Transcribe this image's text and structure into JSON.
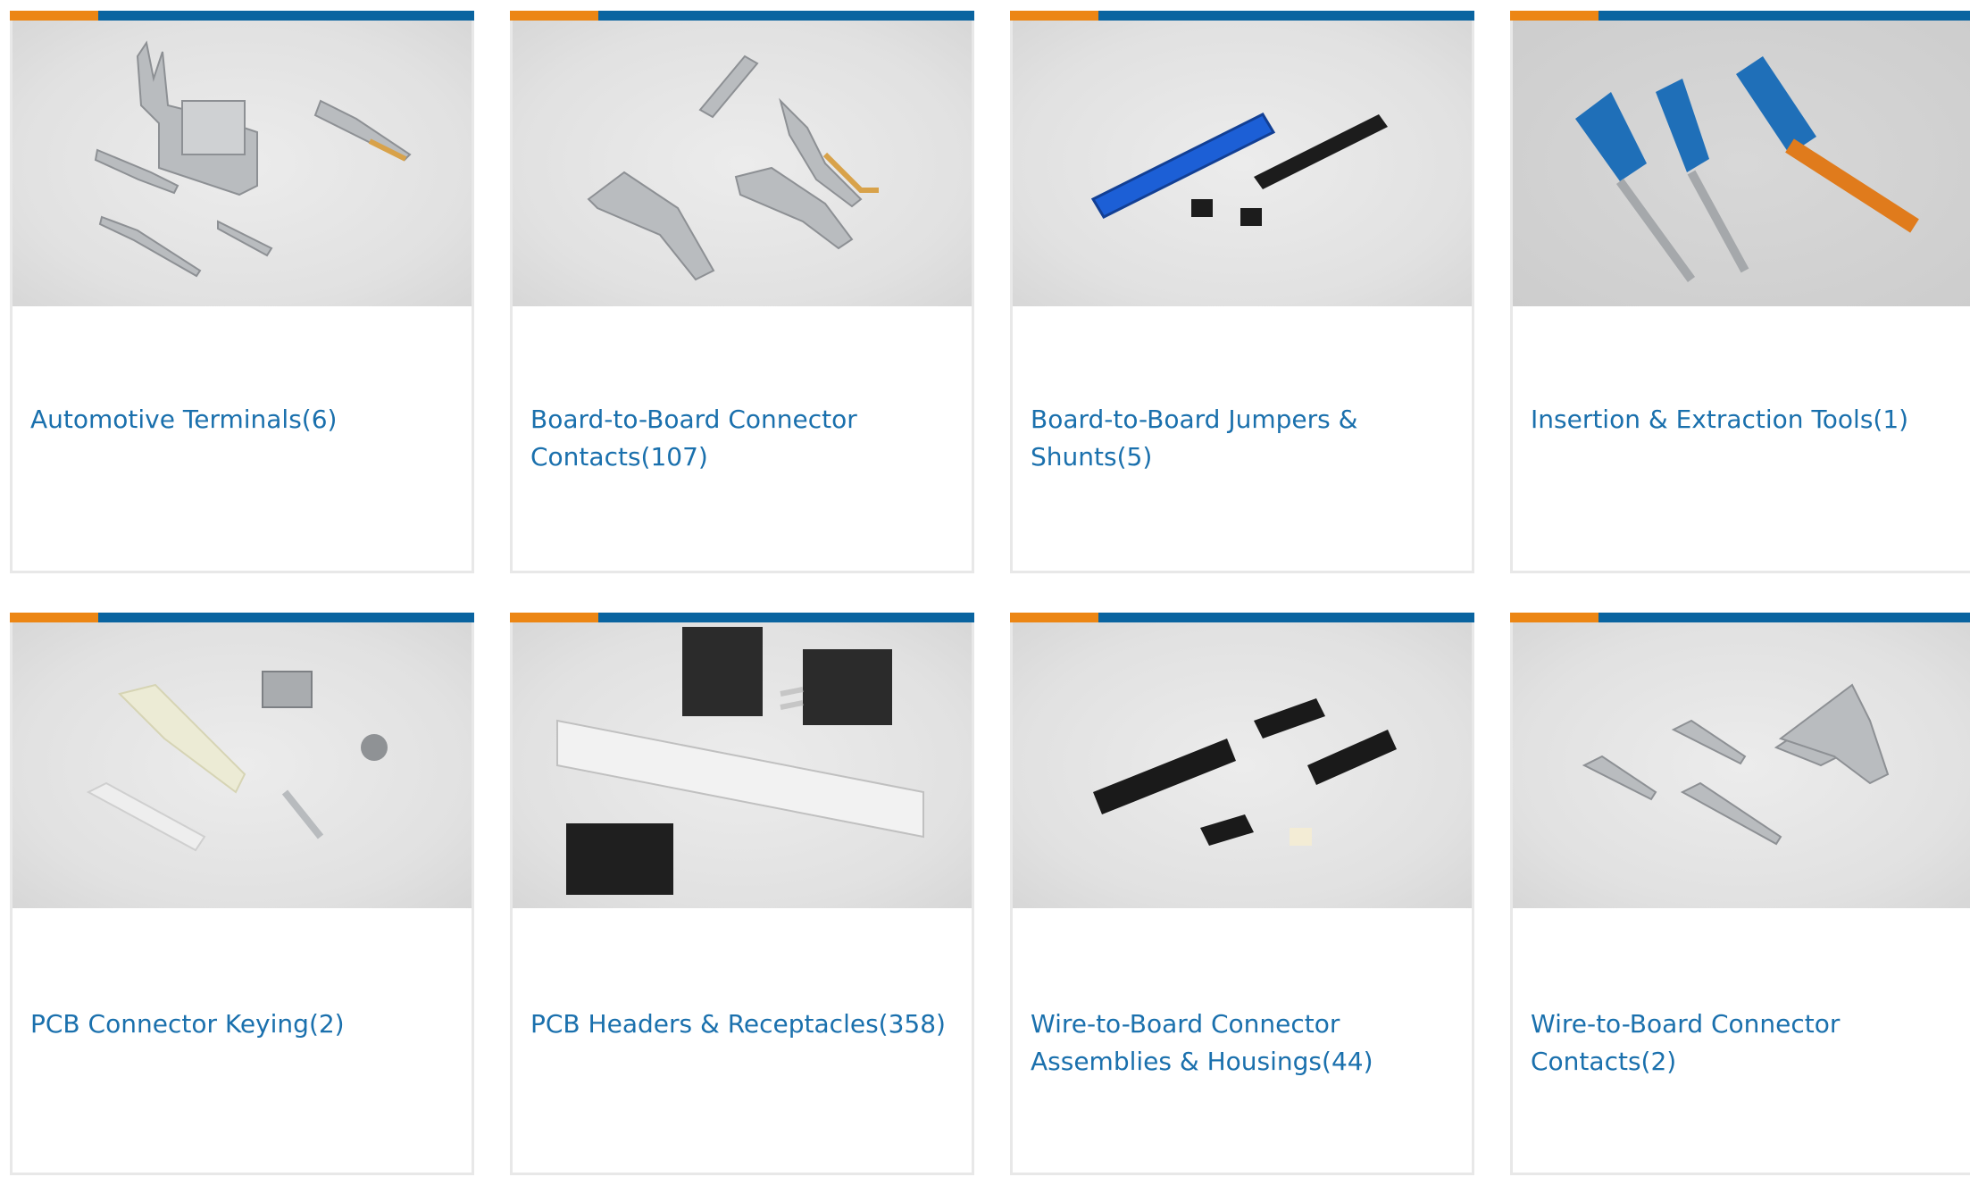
{
  "categories": [
    {
      "name": "Automotive Terminals",
      "count": "(6)",
      "image": "automotive-terminals-photo"
    },
    {
      "name": "Board-to-Board Connector Contacts",
      "count": "(107)",
      "image": "board-to-board-contacts-photo"
    },
    {
      "name": "Board-to-Board Jumpers & Shunts",
      "count": "(5)",
      "image": "jumpers-shunts-photo"
    },
    {
      "name": "Insertion & Extraction Tools",
      "count": "(1)",
      "image": "insertion-extraction-tools-photo"
    },
    {
      "name": "PCB Connector Keying",
      "count": "(2)",
      "image": "pcb-keying-photo"
    },
    {
      "name": "PCB Headers & Receptacles",
      "count": "(358)",
      "image": "pcb-headers-photo"
    },
    {
      "name": "Wire-to-Board Connector Assemblies & Housings",
      "count": "(44)",
      "image": "wire-to-board-housings-photo"
    },
    {
      "name": "Wire-to-Board Connector Contacts",
      "count": "(2)",
      "image": "wire-to-board-contacts-photo"
    }
  ],
  "colors": {
    "accent_orange": "#ec8614",
    "accent_blue": "#0a64a0",
    "link": "#1a70ad",
    "card_border": "#e8e8e8"
  }
}
